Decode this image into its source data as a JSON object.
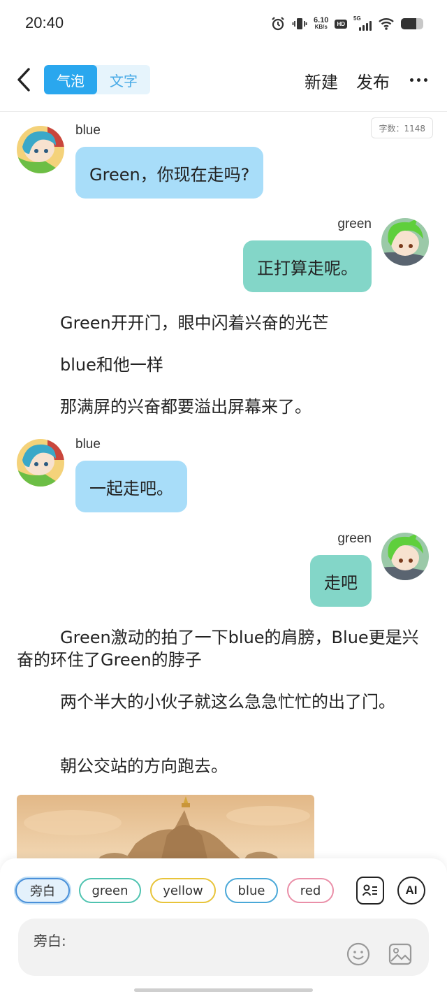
{
  "status_bar": {
    "time": "20:40",
    "net_speed_value": "6.10",
    "net_speed_unit": "KB/s",
    "hd_label": "HD",
    "network_label": "5G",
    "battery_level": 0.7,
    "icons": [
      "alarm-icon",
      "vibrate-icon",
      "hd-icon",
      "signal-5g-icon",
      "wifi-icon",
      "battery-icon"
    ]
  },
  "header": {
    "tabs": [
      {
        "label": "气泡",
        "active": true
      },
      {
        "label": "文字",
        "active": false
      }
    ],
    "new_label": "新建",
    "publish_label": "发布",
    "icons": {
      "back": "chevron-left-icon",
      "more": "more-dots-icon"
    }
  },
  "word_count": "字数：1148",
  "messages": [
    {
      "sender": "blue",
      "text": "Green，你现在走吗?",
      "side": "left"
    },
    {
      "sender": "green",
      "text": "正打算走呢。",
      "side": "right"
    },
    {
      "sender": "blue",
      "text": "一起走吧。",
      "side": "left"
    },
    {
      "sender": "green",
      "text": "走吧",
      "side": "right"
    }
  ],
  "narration": [
    "Green开开门，眼中闪着兴奋的光芒",
    "blue和他一样",
    "那满屏的兴奋都要溢出屏幕来了。",
    "Green激动的拍了一下blue的肩膀，Blue更是兴奋的环住了Green的脖子",
    "两个半大的小伙子就这么急急忙忙的出了门。",
    "朝公交站的方向跑去。"
  ],
  "characters": [
    {
      "label": "旁白",
      "color": "#4a90d9",
      "selected": true
    },
    {
      "label": "green",
      "color": "#4fc3b0",
      "selected": false
    },
    {
      "label": "yellow",
      "color": "#e8c43a",
      "selected": false
    },
    {
      "label": "blue",
      "color": "#4aa8d8",
      "selected": false
    },
    {
      "label": "red",
      "color": "#ea8fa8",
      "selected": false
    }
  ],
  "tools": {
    "profile_icon": "profile-card-icon",
    "ai_label": "AI"
  },
  "input": {
    "label": "旁白:"
  },
  "colors": {
    "accent": "#2aa7ee",
    "bubble_left": "#a8ddf9",
    "bubble_right": "#83d6c8"
  }
}
